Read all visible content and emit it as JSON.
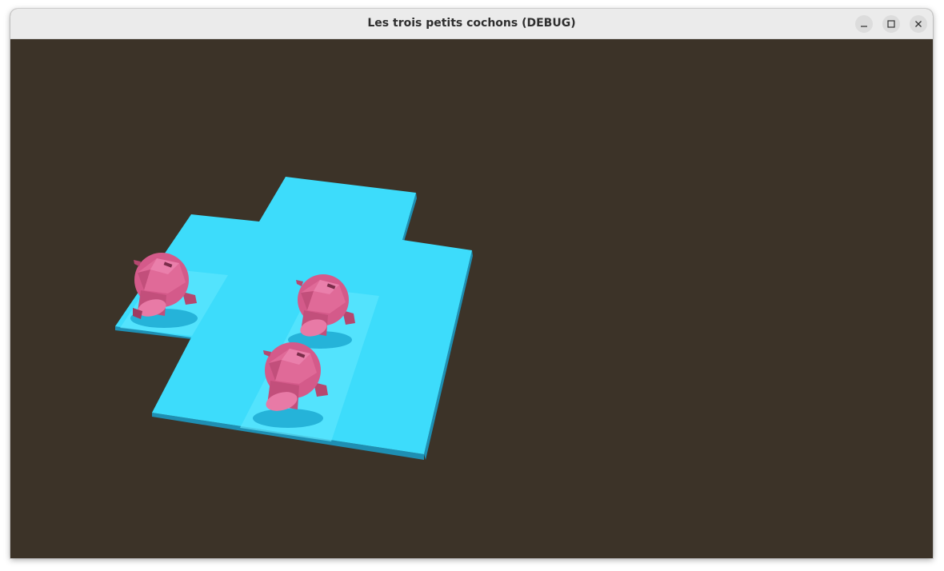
{
  "window": {
    "title": "Les trois petits cochons (DEBUG)",
    "controls": {
      "minimize": "minimize-icon",
      "maximize": "maximize-icon",
      "close": "close-icon"
    }
  },
  "scene": {
    "background_color": "#3c3328",
    "board_color": "#3ddcfb",
    "highlight_color": "#5de6fd",
    "pig_color": "#d45a8a",
    "pig_count": 3
  }
}
